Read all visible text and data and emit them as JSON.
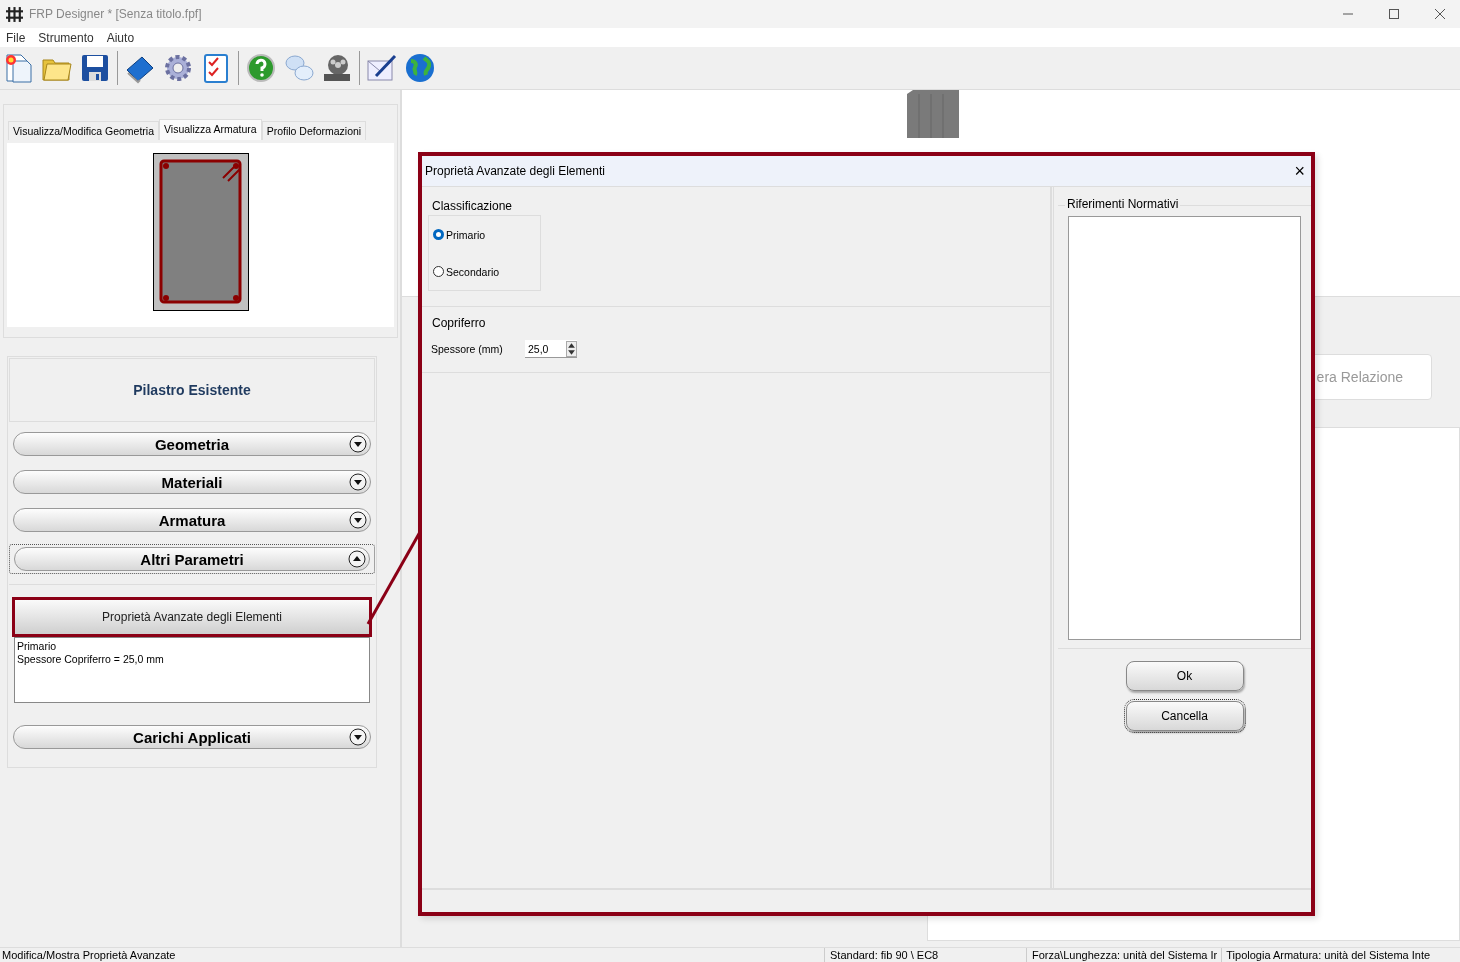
{
  "window": {
    "title": "FRP Designer * [Senza titolo.fpf]"
  },
  "menu": [
    "File",
    "Strumento",
    "Aiuto"
  ],
  "left_panel": {
    "tabs": [
      {
        "label": "Visualizza/Modifica Geometria",
        "selected": false
      },
      {
        "label": "Visualizza Armatura",
        "selected": true
      },
      {
        "label": "Profilo Deformazioni",
        "selected": false
      }
    ],
    "section_title": "Pilastro Esistente",
    "sections": [
      {
        "label": "Geometria",
        "expanded": false
      },
      {
        "label": "Materiali",
        "expanded": false
      },
      {
        "label": "Armatura",
        "expanded": false
      },
      {
        "label": "Altri Parametri",
        "expanded": true
      },
      {
        "label": "Carichi Applicati",
        "expanded": false
      }
    ],
    "advanced_button": "Proprietà Avanzate degli Elementi",
    "summary": [
      "Primario",
      "Spessore Copriferro = 25,0 mm"
    ]
  },
  "background": {
    "report_button": "era Relazione"
  },
  "dialog": {
    "title": "Proprietà Avanzate degli Elementi",
    "close": "×",
    "classification": {
      "title": "Classificazione",
      "options": [
        {
          "label": "Primario",
          "selected": true
        },
        {
          "label": "Secondario",
          "selected": false
        }
      ]
    },
    "cover": {
      "title": "Copriferro",
      "label": "Spessore (mm)",
      "value": "25,0"
    },
    "references": {
      "title": "Riferimenti Normativi"
    },
    "buttons": [
      "Ok",
      "Cancella"
    ]
  },
  "status_bar": [
    "Modifica/Mostra Proprietà Avanzate",
    "Standard: fib 90 \\ EC8",
    "Forza\\Lunghezza: unità del Sistema Ir",
    "Tipologia Armatura: unità del Sistema Inte"
  ]
}
